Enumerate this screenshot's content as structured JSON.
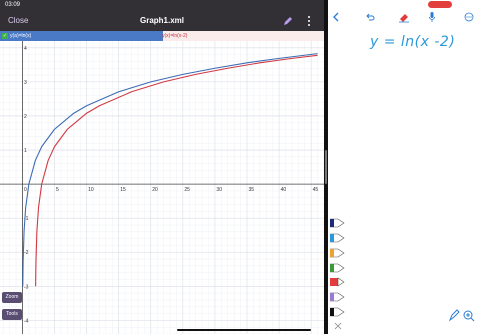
{
  "status_bar": {
    "time": "03:09"
  },
  "nav": {
    "close_label": "Close",
    "title": "Graph1.xml"
  },
  "legend": {
    "f1": "y(a)=ln(x)",
    "f2": "y(x)=ln(x-2)"
  },
  "tools": {
    "zoom_label": "Zoom",
    "tools_label": "Tools"
  },
  "note": {
    "text": "y = ln(x -2)"
  },
  "colors": {
    "accent": "#4a79c6",
    "f2": "#c0303b",
    "note": "#2a98dc"
  },
  "chart_data": {
    "type": "line",
    "x_ticks": [
      0,
      5,
      10,
      15,
      20,
      25,
      30,
      35,
      40,
      45
    ],
    "y_ticks": [
      -4,
      -3,
      -2,
      -1,
      1,
      2,
      3,
      4
    ],
    "xlim": [
      -3.5,
      47
    ],
    "ylim": [
      -4.4,
      4.2
    ],
    "grid": true,
    "series": [
      {
        "name": "y(a)=ln(x)",
        "color": "#3d6cb5",
        "x": [
          0.05,
          0.1,
          0.25,
          0.5,
          1,
          2,
          3,
          5,
          8,
          10,
          15,
          20,
          25,
          30,
          35,
          40,
          46
        ],
        "y": [
          -3.0,
          -2.3,
          -1.39,
          -0.69,
          0,
          0.69,
          1.1,
          1.61,
          2.08,
          2.3,
          2.71,
          3.0,
          3.22,
          3.4,
          3.56,
          3.69,
          3.83
        ]
      },
      {
        "name": "y(x)=ln(x-2)",
        "color": "#d03a44",
        "x": [
          2.05,
          2.1,
          2.25,
          2.5,
          3,
          4,
          5,
          7,
          10,
          12,
          17,
          22,
          27,
          32,
          37,
          42,
          46
        ],
        "y": [
          -3.0,
          -2.3,
          -1.39,
          -0.69,
          0,
          0.69,
          1.1,
          1.61,
          2.08,
          2.3,
          2.71,
          3.0,
          3.22,
          3.4,
          3.56,
          3.69,
          3.78
        ]
      }
    ]
  }
}
